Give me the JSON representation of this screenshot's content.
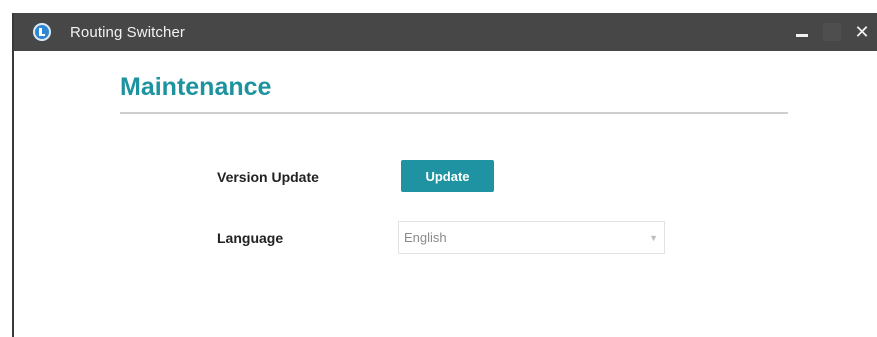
{
  "window": {
    "title": "Routing Switcher",
    "minimize_icon": "minimize-icon",
    "maximize_icon": "maximize-icon",
    "close_icon": "close-icon",
    "close_glyph": "✕"
  },
  "page": {
    "title": "Maintenance"
  },
  "settings": {
    "version_update": {
      "label": "Version Update",
      "button_label": "Update"
    },
    "language": {
      "label": "Language",
      "selected": "English"
    }
  },
  "colors": {
    "accent": "#1e93a0",
    "titlebar": "#474747",
    "app_icon": "#2f86d1"
  }
}
